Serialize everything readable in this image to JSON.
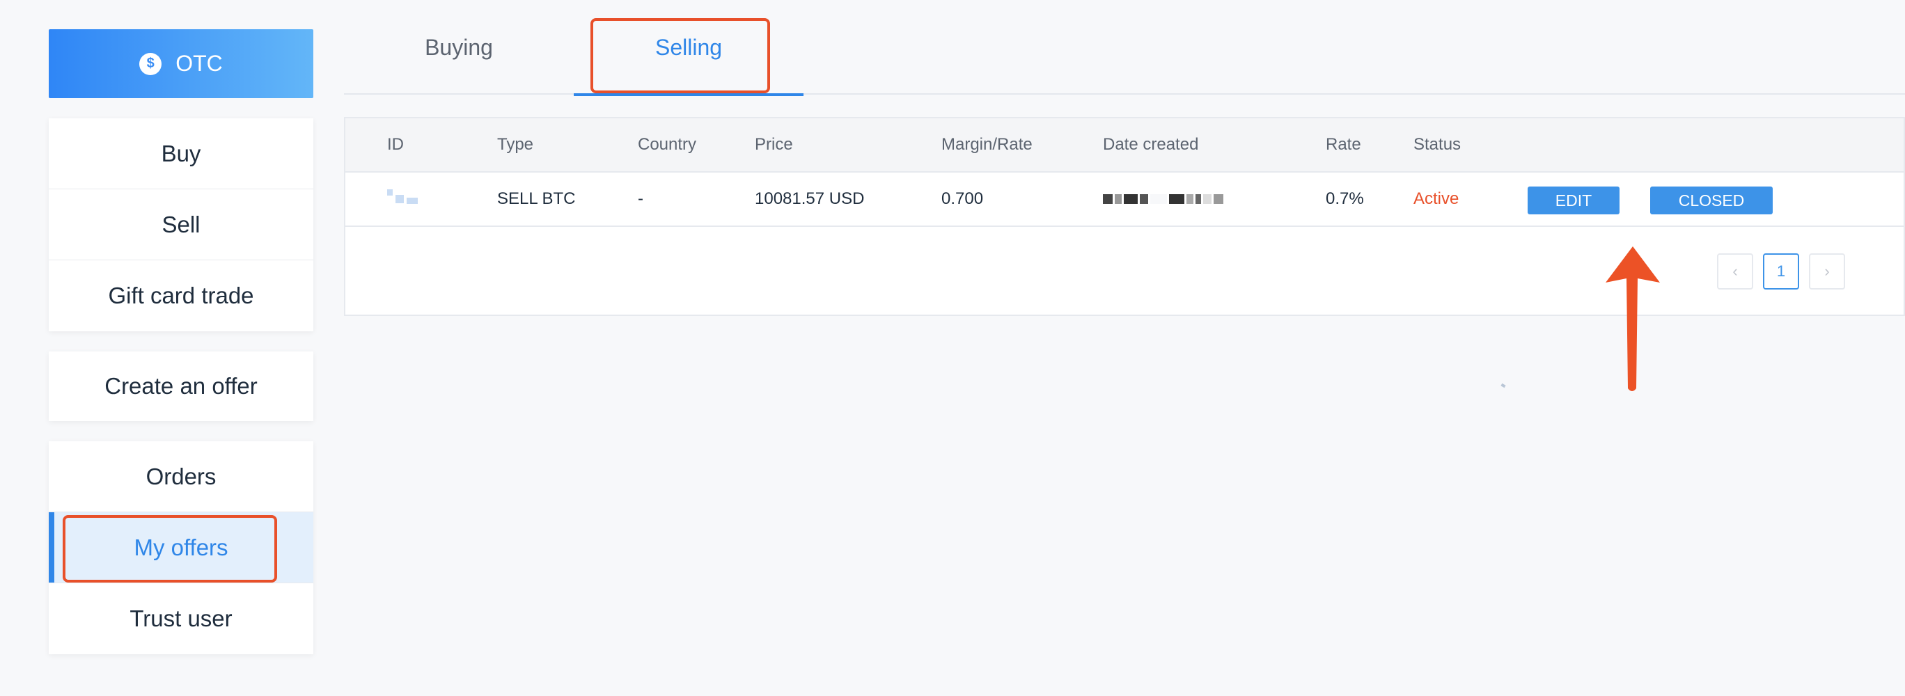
{
  "sidebar": {
    "brand": {
      "label": "OTC",
      "icon": "dollar-coin-icon"
    },
    "trade_menu": [
      {
        "label": "Buy"
      },
      {
        "label": "Sell"
      },
      {
        "label": "Gift card trade"
      }
    ],
    "create_menu": [
      {
        "label": "Create an offer"
      }
    ],
    "account_menu": [
      {
        "label": "Orders"
      },
      {
        "label": "My offers",
        "active": true
      },
      {
        "label": "Trust user"
      }
    ]
  },
  "tabs": [
    {
      "label": "Buying"
    },
    {
      "label": "Selling",
      "active": true
    }
  ],
  "table": {
    "columns": [
      "ID",
      "Type",
      "Country",
      "Price",
      "Margin/Rate",
      "Date created",
      "Rate",
      "Status"
    ],
    "rows": [
      {
        "id": "",
        "type": "SELL BTC",
        "country": "-",
        "price": "10081.57 USD",
        "margin_rate": "0.700",
        "date_created": "",
        "rate": "0.7%",
        "status": "Active",
        "actions": {
          "edit": "EDIT",
          "close": "CLOSED"
        }
      }
    ]
  },
  "pagination": {
    "prev_icon": "chevron-left-icon",
    "current_page": "1",
    "next_icon": "chevron-right-icon"
  },
  "annotations": {
    "highlight_color": "#e8502a",
    "arrow_icon": "red-arrow-up-icon"
  },
  "colors": {
    "accent": "#2f86e8",
    "status_active": "#e8502a",
    "button_blue": "#3d93e8"
  }
}
